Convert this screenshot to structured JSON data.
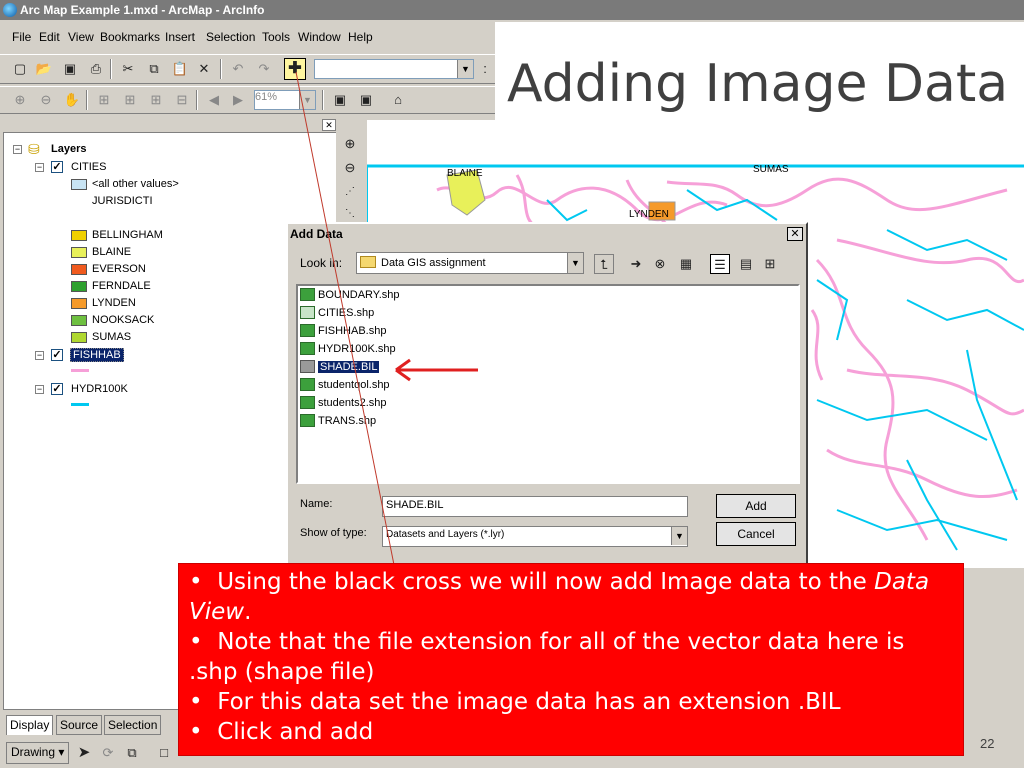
{
  "window": {
    "title": "Arc Map Example 1.mxd - ArcMap - ArcInfo"
  },
  "menu": [
    "File",
    "Edit",
    "View",
    "Bookmarks",
    "Insert",
    "Selection",
    "Tools",
    "Window",
    "Help"
  ],
  "toolbar": {
    "scale_value": "",
    "zoom_value": "61%"
  },
  "slide": {
    "title": "Adding Image Data",
    "page_number": "22"
  },
  "toc": {
    "root": "Layers",
    "layers": [
      {
        "name": "CITIES",
        "items": [
          "<all other values>",
          "JURISDICTI",
          "BELLINGHAM",
          "BLAINE",
          "EVERSON",
          "FERNDALE",
          "LYNDEN",
          "NOOKSACK",
          "SUMAS"
        ]
      },
      {
        "name": "FISHHAB"
      },
      {
        "name": "HYDR100K"
      }
    ],
    "colors": {
      "all_other": "#c8e4f4",
      "BELLINGHAM": "#f0d000",
      "BLAINE": "#e8f05a",
      "EVERSON": "#f05a1e",
      "FERNDALE": "#2ea02e",
      "LYNDEN": "#f59a2a",
      "NOOKSACK": "#6ec040",
      "SUMAS": "#b0d830",
      "FISHHAB": "#f6a0d8",
      "HYDR100K": "#00c8f0"
    }
  },
  "map_labels": [
    "BLAINE",
    "SUMAS",
    "LYNDEN"
  ],
  "dialog": {
    "title": "Add Data",
    "look_in_label": "Look in:",
    "look_in_value": "Data GIS assignment",
    "files": [
      "BOUNDARY.shp",
      "CITIES.shp",
      "FISHHAB.shp",
      "HYDR100K.shp",
      "SHADE.BIL",
      "studentqol.shp",
      "students2.shp",
      "TRANS.shp"
    ],
    "selected_file": "SHADE.BIL",
    "name_label": "Name:",
    "name_value": "SHADE.BIL",
    "type_label": "Show of type:",
    "type_value": "Datasets and Layers (*.lyr)",
    "add_label": "Add",
    "cancel_label": "Cancel"
  },
  "tabs": [
    "Display",
    "Source",
    "Selection"
  ],
  "drawing_label": "Drawing",
  "callout": {
    "bullet_1a": "Using the black cross we will now add Image data to the",
    "bullet_1b": "Data View",
    "bullet_1c": ".",
    "bullet_2": "Note that the file extension for all of the vector data here is .shp (shape file)",
    "bullet_3": "For this data set the image data has an extension .BIL",
    "bullet_4": "Click and add"
  }
}
